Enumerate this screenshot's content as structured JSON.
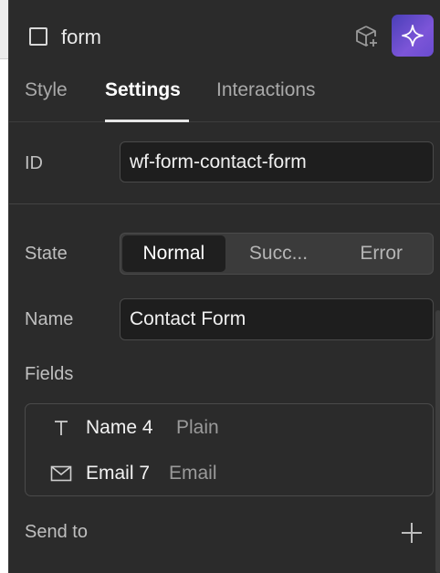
{
  "header": {
    "element_name": "form",
    "icons": {
      "cube": "cube-plus-icon",
      "ai": "sparkle-icon"
    },
    "accent": "#6a4cd0"
  },
  "tabs": [
    {
      "label": "Style",
      "active": false
    },
    {
      "label": "Settings",
      "active": true
    },
    {
      "label": "Interactions",
      "active": false
    }
  ],
  "settings": {
    "id_label": "ID",
    "id_value": "wf-form-contact-form",
    "state_label": "State",
    "states": [
      {
        "label": "Normal",
        "active": true
      },
      {
        "label": "Succ...",
        "active": false
      },
      {
        "label": "Error",
        "active": false
      }
    ],
    "name_label": "Name",
    "name_value": "Contact Form",
    "fields_label": "Fields",
    "fields": [
      {
        "icon": "text-icon",
        "name": "Name 4",
        "type": "Plain"
      },
      {
        "icon": "email-icon",
        "name": "Email 7",
        "type": "Email"
      }
    ],
    "send_to_label": "Send to",
    "send_to_icon": "plus-icon"
  }
}
